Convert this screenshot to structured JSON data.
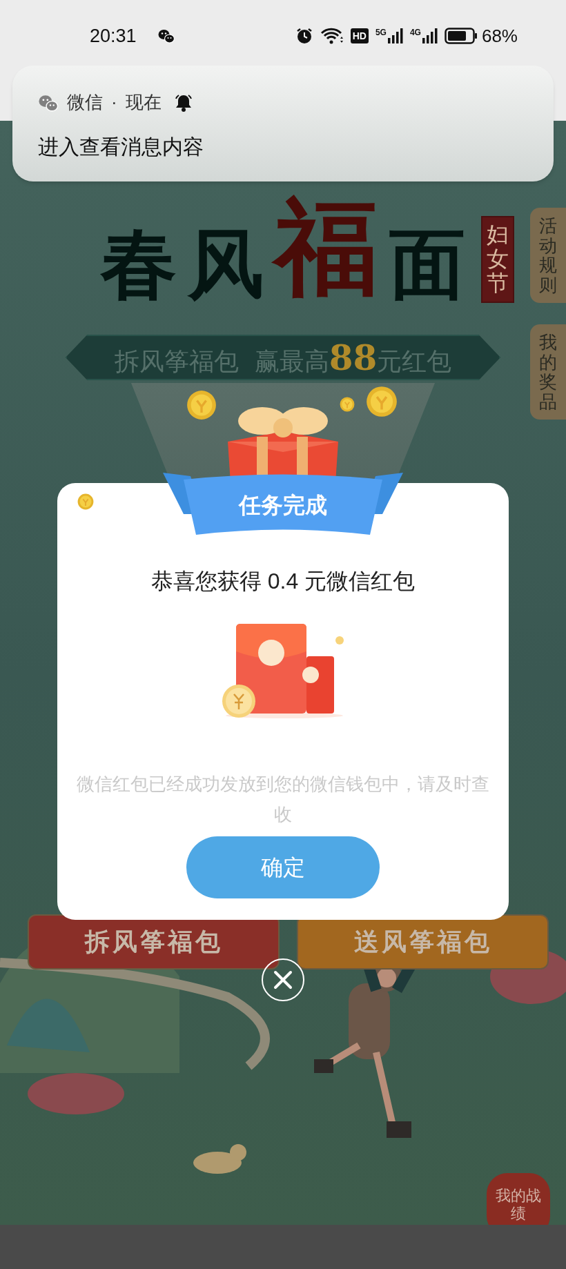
{
  "status_bar": {
    "time": "20:31",
    "hd": "HD",
    "networks": [
      "5G",
      "4G"
    ],
    "battery": "68%"
  },
  "notification": {
    "app": "微信",
    "separator": "·",
    "time": "现在",
    "message": "进入查看消息内容"
  },
  "page": {
    "title": [
      {
        "text": "春",
        "accent": false
      },
      {
        "text": "风",
        "accent": false
      },
      {
        "text": "福",
        "accent": true
      },
      {
        "text": "面",
        "accent": false
      }
    ],
    "festival_tag": "妇女节",
    "side_tabs": [
      "活动规则",
      "我的奖品"
    ],
    "banner": {
      "before": "拆风筝福包  赢最高",
      "amount": "88",
      "after": "元红包"
    },
    "action_buttons": [
      {
        "label": "拆风筝福包",
        "color": "#8a2f28"
      },
      {
        "label": "送风筝福包",
        "color": "#a2671f"
      }
    ],
    "record_badge": "我的战绩"
  },
  "dialog": {
    "ribbon": "任务完成",
    "headline": "恭喜您获得 0.4 元微信红包",
    "note": "微信红包已经成功发放到您的微信钱包中，请及时查收",
    "confirm": "确定"
  }
}
